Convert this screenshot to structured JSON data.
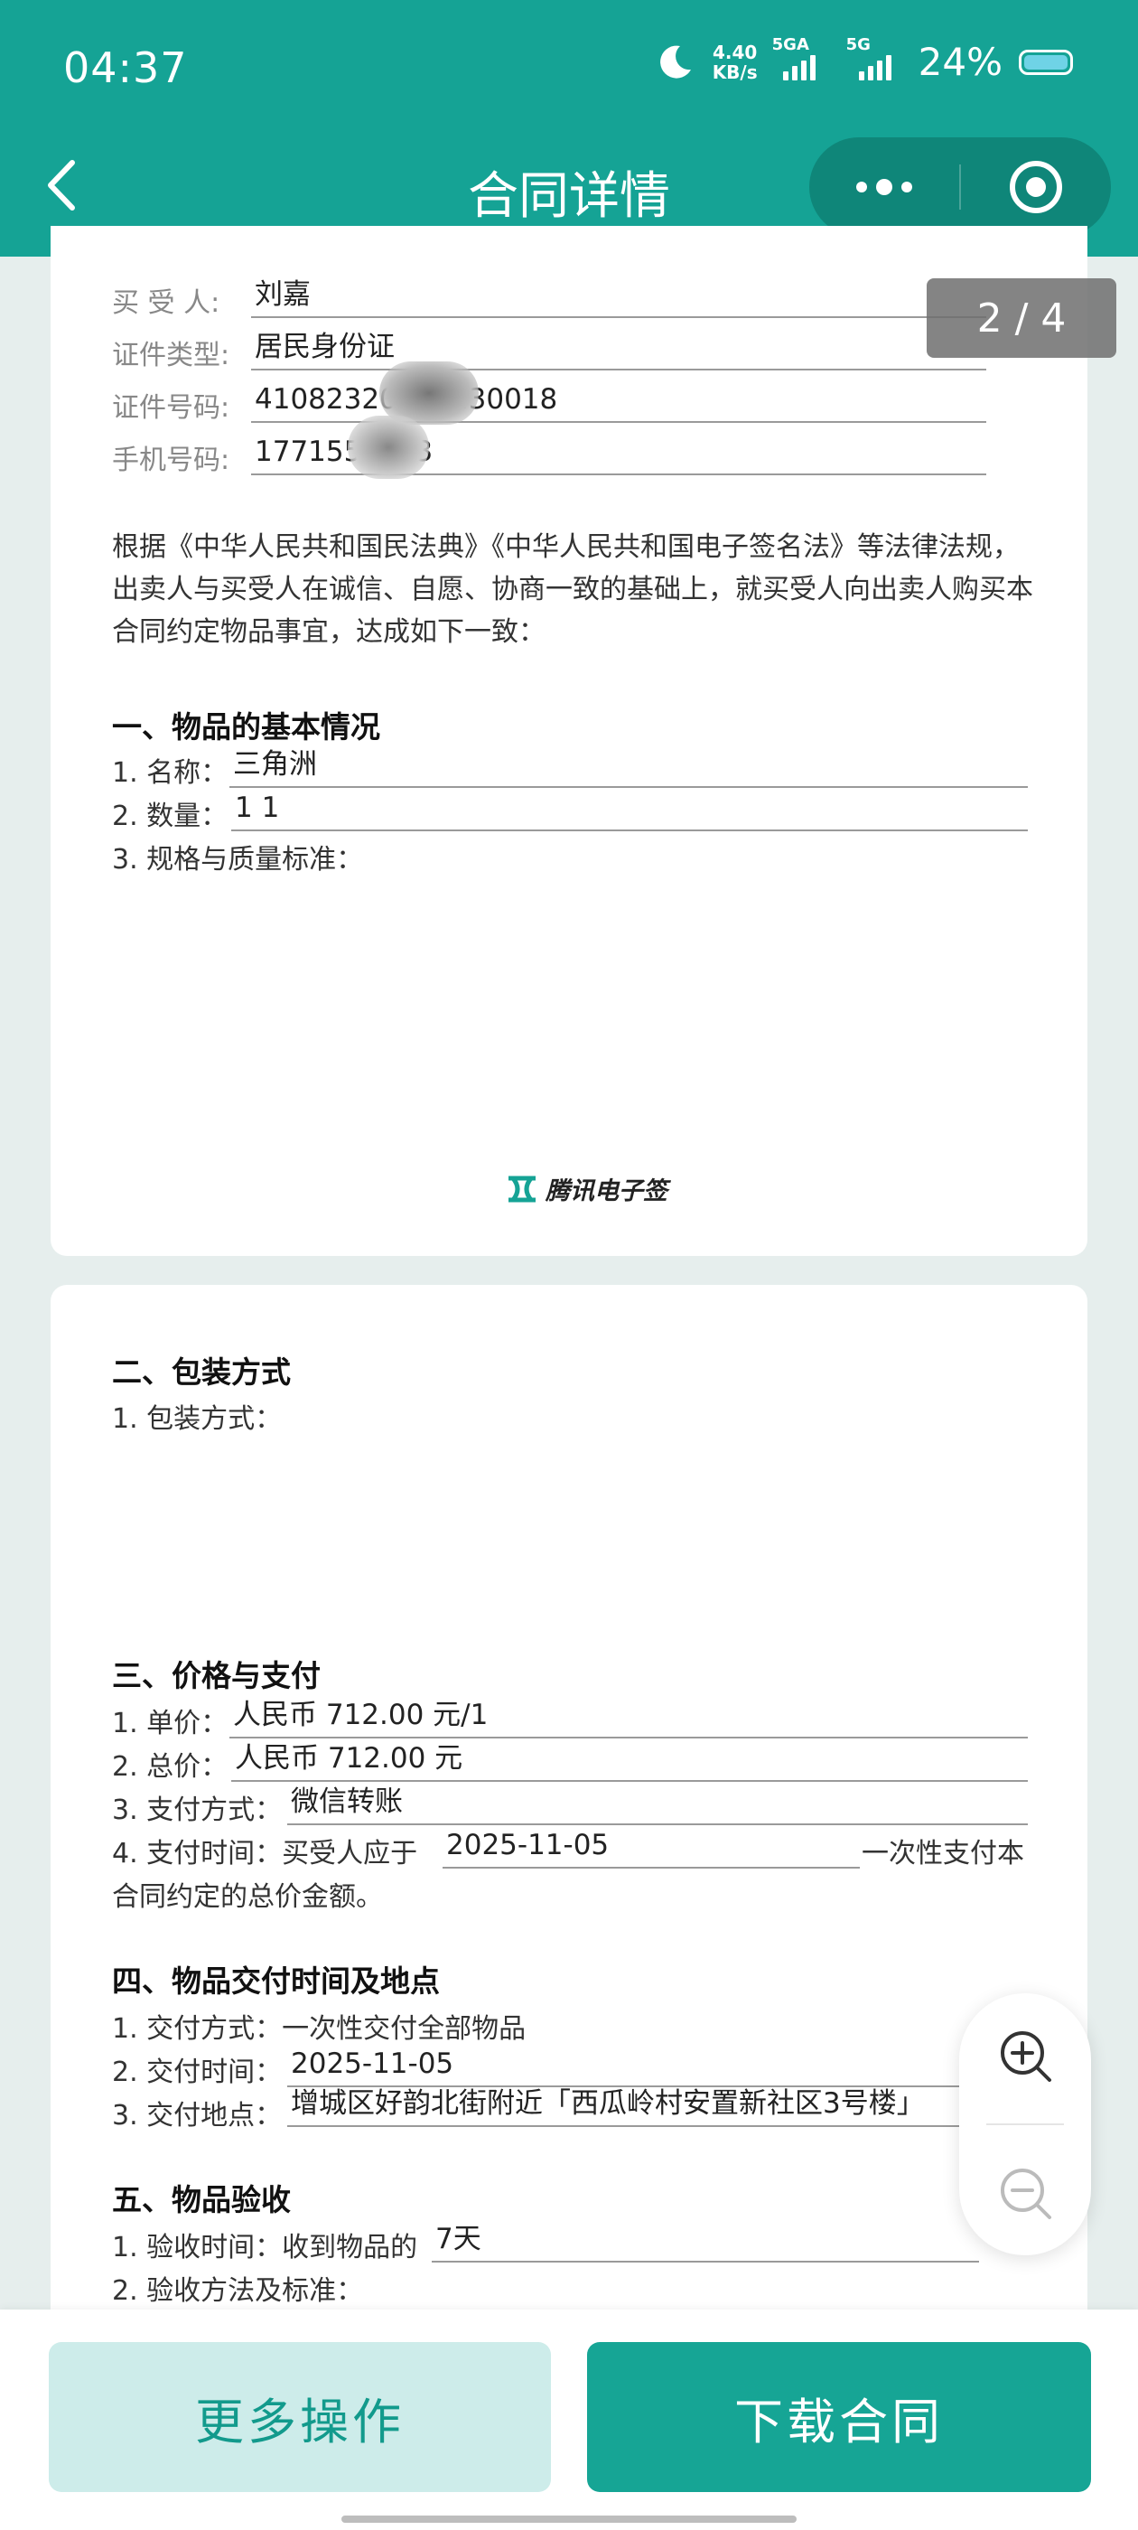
{
  "status_bar": {
    "time": "04:37",
    "net_speed": "4.40",
    "net_unit": "KB/s",
    "sig1_label": "5GA",
    "sig2_label": "5G",
    "battery": "24%",
    "icons": [
      "moon-icon",
      "signal-icon",
      "battery-icon"
    ]
  },
  "header": {
    "title": "合同详情",
    "icons": [
      "back-icon",
      "more-icon",
      "target-icon"
    ]
  },
  "page_indicator": "2 / 4",
  "buyer": {
    "name_label": "买 受 人:",
    "name": "刘嘉",
    "id_type_label": "证件类型:",
    "id_type": "居民身份证",
    "id_no_label": "证件号码:",
    "id_no": "41082320      230018",
    "phone_label": "手机号码:",
    "phone": "1771550    3"
  },
  "intro": "根据《中华人民共和国民法典》《中华人民共和国电子签名法》等法律法规，出卖人与买受人在诚信、自愿、协商一致的基础上，就买受人向出卖人购买本合同约定物品事宜，达成如下一致：",
  "section1": {
    "title": "一、物品的基本情况",
    "name_label": "1. 名称：",
    "name": "三角洲",
    "qty_label": "2. 数量：",
    "qty": "1 1",
    "spec_label": "3. 规格与质量标准："
  },
  "watermark": "腾讯电子签",
  "section2": {
    "title": "二、包装方式",
    "item1": "1. 包装方式："
  },
  "section3": {
    "title": "三、价格与支付",
    "unit_price_label": "1. 单价：",
    "unit_price": "人民币 712.00 元/1",
    "total_label": "2. 总价：",
    "total": "人民币 712.00 元",
    "method_label": "3. 支付方式：",
    "method": "微信转账",
    "time_label": "4. 支付时间：买受人应于",
    "time": "2025-11-05",
    "time_suffix": "一次性支付本",
    "time_line2": "合同约定的总价金额。"
  },
  "section4": {
    "title": "四、物品交付时间及地点",
    "mode": "1. 交付方式：一次性交付全部物品",
    "time_label": "2. 交付时间：",
    "time": "2025-11-05",
    "place_label": "3. 交付地点：",
    "place": "增城区好韵北街附近「西瓜岭村安置新社区3号楼」"
  },
  "section5": {
    "title": "五、物品验收",
    "time_label": "1. 验收时间：收到物品的",
    "time": "7天",
    "method_label": "2. 验收方法及标准："
  },
  "zoom": {
    "in_icon": "zoom-in-icon",
    "out_icon": "zoom-out-icon"
  },
  "buttons": {
    "more": "更多操作",
    "download": "下载合同"
  },
  "colors": {
    "brand": "#15a395",
    "brand_dark": "#0f8679",
    "button_light": "#cdecea"
  }
}
